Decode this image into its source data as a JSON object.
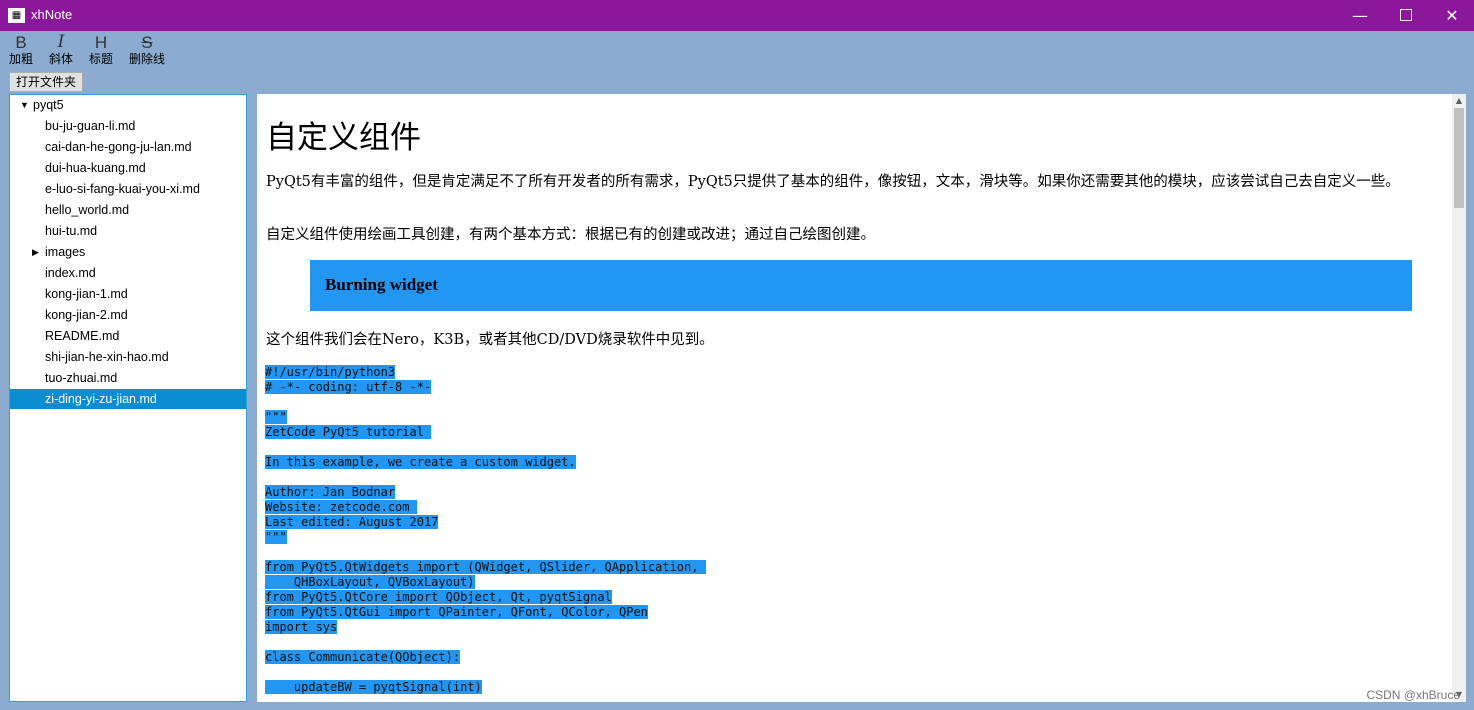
{
  "window": {
    "title": "xhNote",
    "minimize_glyph": "—",
    "close_glyph": "✕"
  },
  "toolbar": {
    "bold": {
      "glyph": "B",
      "label": "加粗"
    },
    "italic": {
      "glyph": "I",
      "label": "斜体"
    },
    "heading": {
      "glyph": "H",
      "label": "标题"
    },
    "strike": {
      "glyph": "S",
      "label": "删除线"
    }
  },
  "open_folder_label": "打开文件夹",
  "tree": {
    "root": "pyqt5",
    "items": [
      {
        "label": "bu-ju-guan-li.md"
      },
      {
        "label": "cai-dan-he-gong-ju-lan.md"
      },
      {
        "label": "dui-hua-kuang.md"
      },
      {
        "label": "e-luo-si-fang-kuai-you-xi.md"
      },
      {
        "label": "hello_world.md"
      },
      {
        "label": "hui-tu.md"
      },
      {
        "label": "images",
        "folder": true
      },
      {
        "label": "index.md"
      },
      {
        "label": "kong-jian-1.md"
      },
      {
        "label": "kong-jian-2.md"
      },
      {
        "label": "README.md"
      },
      {
        "label": "shi-jian-he-xin-hao.md"
      },
      {
        "label": "tuo-zhuai.md"
      },
      {
        "label": "zi-ding-yi-zu-jian.md",
        "selected": true
      }
    ]
  },
  "document": {
    "title": "自定义组件",
    "para1": "PyQt5有丰富的组件，但是肯定满足不了所有开发者的所有需求，PyQt5只提供了基本的组件，像按钮，文本，滑块等。如果你还需要其他的模块，应该尝试自己去自定义一些。",
    "para2": "自定义组件使用绘画工具创建，有两个基本方式：根据已有的创建或改进；通过自己绘图创建。",
    "quote": "Burning widget",
    "para3": "这个组件我们会在Nero，K3B，或者其他CD/DVD烧录软件中见到。",
    "code_lines": [
      "#!/usr/bin/python3",
      "# -*- coding: utf-8 -*-",
      "",
      "\"\"\"",
      "ZetCode PyQt5 tutorial ",
      "",
      "In this example, we create a custom widget.",
      "",
      "Author: Jan Bodnar",
      "Website: zetcode.com ",
      "Last edited: August 2017",
      "\"\"\"",
      "",
      "from PyQt5.QtWidgets import (QWidget, QSlider, QApplication, ",
      "    QHBoxLayout, QVBoxLayout)",
      "from PyQt5.QtCore import QObject, Qt, pyqtSignal",
      "from PyQt5.QtGui import QPainter, QFont, QColor, QPen",
      "import sys",
      "",
      "class Communicate(QObject):",
      "",
      "    updateBW = pyqtSignal(int)"
    ]
  },
  "watermark": "CSDN @xhBruce",
  "colors": {
    "titlebar": "#8b179a",
    "background": "#8cabd0",
    "selection": "#0a8ed1",
    "highlight": "#2196f3"
  }
}
